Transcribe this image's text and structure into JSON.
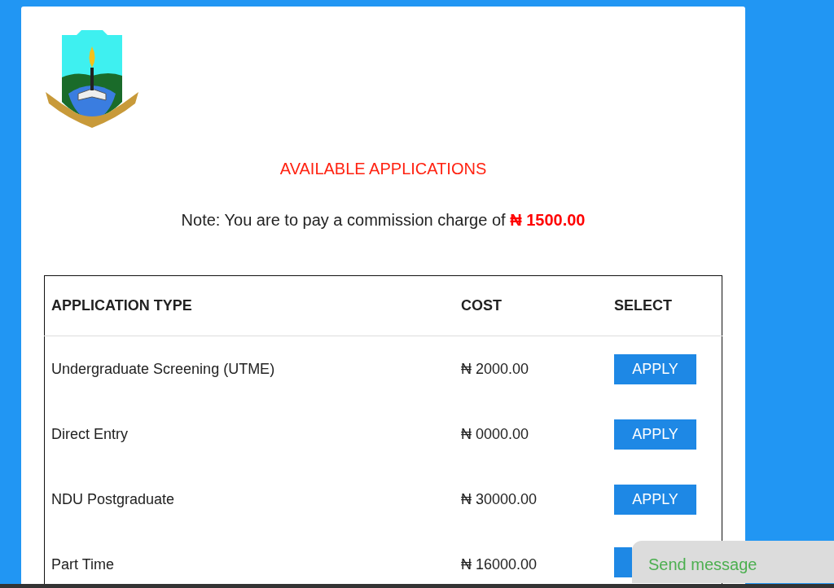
{
  "heading": "AVAILABLE APPLICATIONS",
  "note": {
    "text": "Note: You are to pay a commission charge of",
    "amount": "₦ 1500.00"
  },
  "table": {
    "columns": [
      "APPLICATION TYPE",
      "COST",
      "SELECT"
    ],
    "rows": [
      {
        "type": "Undergraduate Screening (UTME)",
        "cost": "₦ 2000.00",
        "button": "APPLY"
      },
      {
        "type": "Direct Entry",
        "cost": "₦ 0000.00",
        "button": "APPLY"
      },
      {
        "type": "NDU Postgraduate",
        "cost": "₦ 30000.00",
        "button": "APPLY"
      },
      {
        "type": "Part Time",
        "cost": "₦ 16000.00"
      }
    ]
  },
  "chat_widget": {
    "label": "Send message"
  }
}
